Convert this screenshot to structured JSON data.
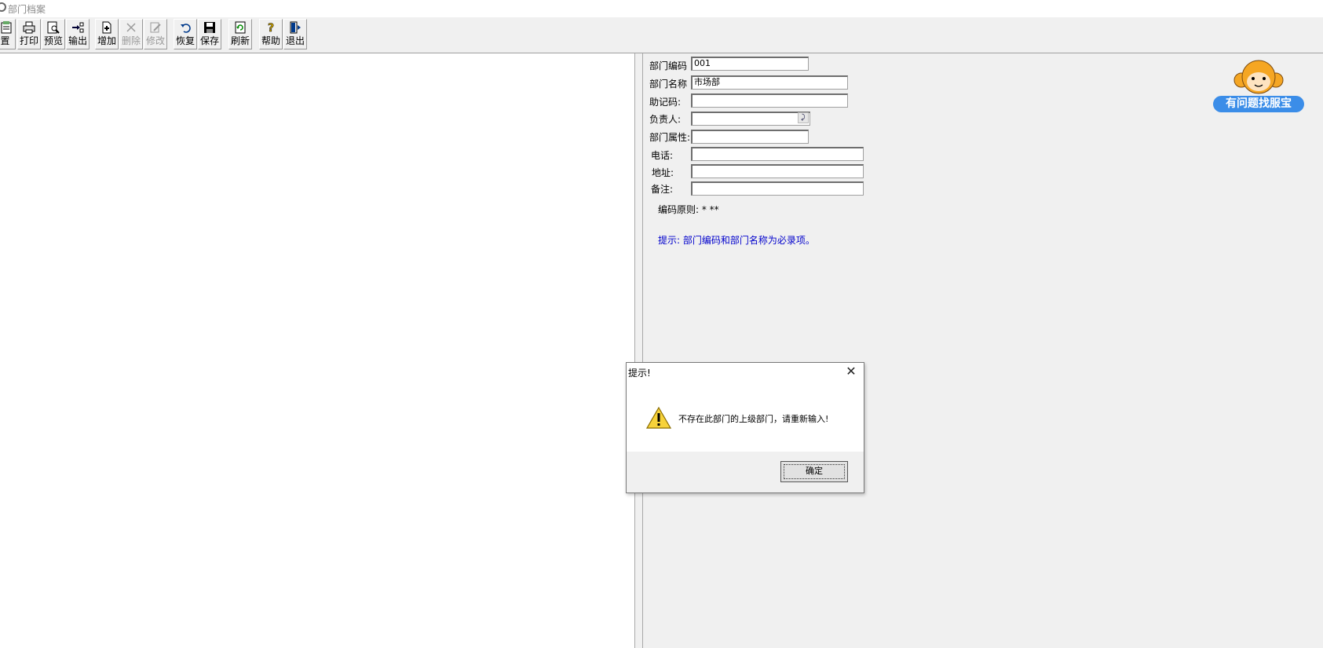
{
  "window": {
    "title": "部门档案"
  },
  "toolbar": {
    "buttons": [
      {
        "label": "设置",
        "icon": "setup-icon",
        "enabled": true
      },
      {
        "label": "打印",
        "icon": "printer-icon",
        "enabled": true
      },
      {
        "label": "预览",
        "icon": "preview-icon",
        "enabled": true
      },
      {
        "label": "输出",
        "icon": "export-icon",
        "enabled": true
      },
      {
        "label": "增加",
        "icon": "add-document-icon",
        "enabled": true
      },
      {
        "label": "删除",
        "icon": "delete-x-icon",
        "enabled": false
      },
      {
        "label": "修改",
        "icon": "edit-icon",
        "enabled": false
      },
      {
        "label": "恢复",
        "icon": "undo-arrow-icon",
        "enabled": true
      },
      {
        "label": "保存",
        "icon": "floppy-disk-icon",
        "enabled": true
      },
      {
        "label": "刷新",
        "icon": "refresh-icon",
        "enabled": true
      },
      {
        "label": "帮助",
        "icon": "help-question-icon",
        "enabled": true
      },
      {
        "label": "退出",
        "icon": "exit-door-icon",
        "enabled": true
      }
    ]
  },
  "form": {
    "dept_code_label": "部门编码",
    "dept_code_value": "001",
    "dept_name_label": "部门名称",
    "dept_name_value": "市场部",
    "mnemonic_label": "助记码:",
    "mnemonic_value": "",
    "manager_label": "负责人:",
    "manager_value": "",
    "attribute_label": "部门属性:",
    "attribute_value": "",
    "phone_label": "电话:",
    "phone_value": "",
    "address_label": "地址:",
    "address_value": "",
    "remark_label": "备注:",
    "remark_value": "",
    "coding_rule": "编码原则: * **",
    "hint": "提示: 部门编码和部门名称为必录项。"
  },
  "mascot": {
    "badge_text": "有问题找服宝"
  },
  "dialog": {
    "title": "提示!",
    "message": "不存在此部门的上级部门，请重新输入!",
    "ok_label": "确定"
  },
  "colors": {
    "hint_text": "#0000cc",
    "badge_bg": "#3b8de8",
    "mascot_face": "#f5a623"
  }
}
